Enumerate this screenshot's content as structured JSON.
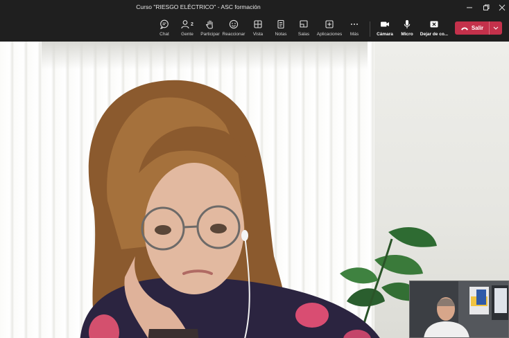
{
  "window": {
    "title": "Curso \"RIESGO ELÉCTRICO\" - ASC formación"
  },
  "toolbar": {
    "buttons": [
      {
        "label": "Chat",
        "icon": "chat-icon"
      },
      {
        "label": "Gente",
        "icon": "people-icon",
        "badge": "2"
      },
      {
        "label": "Participar",
        "icon": "raise-hand-icon"
      },
      {
        "label": "Reaccionar",
        "icon": "smiley-icon"
      },
      {
        "label": "Vista",
        "icon": "view-grid-icon"
      },
      {
        "label": "Notas",
        "icon": "notes-icon"
      },
      {
        "label": "Salas",
        "icon": "rooms-icon"
      },
      {
        "label": "Aplicaciones",
        "icon": "apps-plus-icon"
      },
      {
        "label": "Más",
        "icon": "more-dots-icon"
      }
    ],
    "media": [
      {
        "label": "Cámara",
        "icon": "camera-icon"
      },
      {
        "label": "Micro",
        "icon": "microphone-icon"
      },
      {
        "label": "Dejar de co...",
        "icon": "stop-share-icon"
      }
    ],
    "leave_label": "Salir",
    "leave_color": "#c4314b"
  },
  "colors": {
    "chrome": "#1f1f1f",
    "label": "#d6d6d6"
  }
}
